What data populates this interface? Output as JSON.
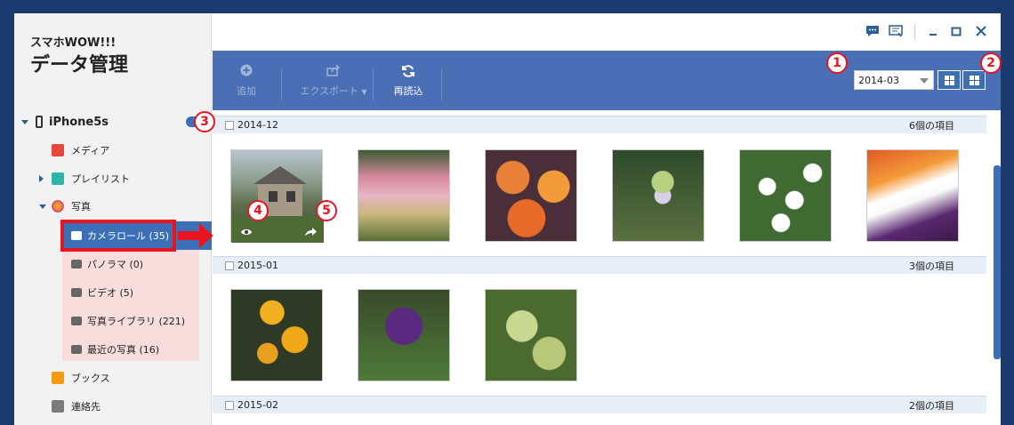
{
  "app": {
    "brand_small": "スマホWOW!!!",
    "brand_big": "データ管理"
  },
  "sidebar": {
    "device": "iPhone5s",
    "items": [
      {
        "label": "メディア",
        "color": "#e8463c"
      },
      {
        "label": "プレイリスト",
        "color": "#2db5a8"
      },
      {
        "label": "写真",
        "color": "#f0a020"
      },
      {
        "label": "ブックス",
        "color": "#f39c12"
      },
      {
        "label": "連絡先",
        "color": "#7a7a7a"
      }
    ],
    "photo_sub": [
      {
        "label": "カメラロール (35)"
      },
      {
        "label": "パノラマ (0)"
      },
      {
        "label": "ビデオ (5)"
      },
      {
        "label": "写真ライブラリ (221)"
      },
      {
        "label": "最近の写真 (16)"
      }
    ]
  },
  "toolbar": {
    "add_label": "追加",
    "export_label": "エクスポート",
    "reload_label": "再読込",
    "date_value": "2014-03"
  },
  "groups": [
    {
      "date": "2014-12",
      "count": "6個の項目"
    },
    {
      "date": "2015-01",
      "count": "3個の項目"
    },
    {
      "date": "2015-02",
      "count": "2個の項目"
    }
  ],
  "badges": {
    "b1": "1",
    "b2": "2",
    "b3": "3",
    "b4": "4",
    "b5": "5"
  },
  "colors": {
    "accent": "#4a6fb5",
    "highlight": "#e8141e"
  }
}
